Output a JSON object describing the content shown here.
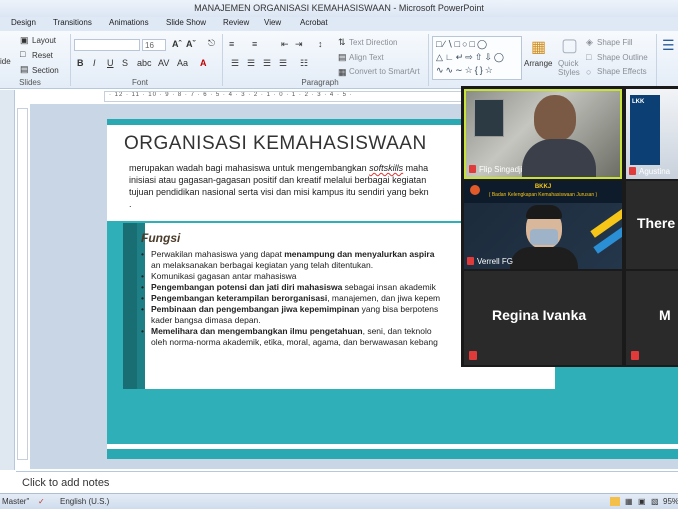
{
  "window": {
    "title": "MANAJEMEN ORGANISASI KEMAHASISWAAN - Microsoft PowerPoint"
  },
  "ribbon_tabs": [
    "Design",
    "Transitions",
    "Animations",
    "Slide Show",
    "Review",
    "View",
    "Acrobat"
  ],
  "ribbon": {
    "slides": {
      "label": "Slides",
      "layout": "Layout",
      "reset": "Reset",
      "section": "Section",
      "new_slide_partial": "ide"
    },
    "font": {
      "label": "Font",
      "size": "16"
    },
    "paragraph": {
      "label": "Paragraph",
      "text_direction": "Text Direction",
      "align_text": "Align Text",
      "convert_smartart": "Convert to SmartArt"
    },
    "drawing": {
      "arrange": "Arrange",
      "quick_styles": "Quick Styles",
      "shape_fill": "Shape Fill",
      "shape_outline": "Shape Outline",
      "shape_effects": "Shape Effects"
    }
  },
  "ruler_ticks": "· 12 · 11 · 10 · 9 · 8 · 7 · 6 · 5 · 4 · 3 · 2 · 1 · 0 · 1 · 2 · 3 · 4 · 5 ·",
  "slide": {
    "title": "ORGANISASI KEMAHASISWAAN",
    "intro_pre": "merupakan wadah bagi mahasiswa untuk mengembangkan ",
    "intro_soft": "softskills",
    "intro_post": " maha",
    "intro_line2": "inisiasi atau gagasan-gagasan positif dan kreatif melalui berbagai kegiatan",
    "intro_line3": "tujuan pendidikan nasional serta visi dan misi kampus itu sendiri yang bekn",
    "intro_line4": ".",
    "box_title": "Fungsi",
    "items": [
      {
        "pre": "Perwakilan mahasiswa yang dapat ",
        "bold": "menampung dan menyalurkan aspira",
        "post": ""
      },
      {
        "pre": "an melaksanakan berbagai kegiatan yang telah ditentukan.",
        "bold": "",
        "post": "",
        "cont": true
      },
      {
        "pre": "Komunikasi gagasan antar mahasiswa",
        "bold": "",
        "post": ""
      },
      {
        "pre": "",
        "bold": "Pengembangan potensi dan jati diri mahasiswa",
        "post": " sebagai insan akademik"
      },
      {
        "pre": "",
        "bold": "Pengembangan keterampilan berorganisasi",
        "post": ", manajemen, dan jiwa kepem"
      },
      {
        "pre": "",
        "bold": "Pembinaan dan pengembangan jiwa kepemimpinan",
        "post": " yang bisa berpotens"
      },
      {
        "pre": "kader bangsa dimasa depan.",
        "bold": "",
        "post": "",
        "cont": true
      },
      {
        "pre": "",
        "bold": "Memelihara dan mengembangkan ilmu pengetahuan",
        "post": ", seni, dan teknolo"
      },
      {
        "pre": "oleh norma-norma akademik, etika, moral, agama, dan berwawasan kebang",
        "bold": "",
        "post": "",
        "cont": true
      }
    ]
  },
  "notes": {
    "placeholder": "Click to add notes"
  },
  "status": {
    "mode": "Master\"",
    "language": "English (U.S.)",
    "zoom": "95%"
  },
  "zoom_call": {
    "participants": [
      {
        "name": "Flip Singadji"
      },
      {
        "name": "Agustina"
      },
      {
        "name": "Verrell FG"
      },
      {
        "name": "There"
      },
      {
        "name": "Regina Ivanka"
      },
      {
        "name": "M"
      }
    ],
    "tile2_logo": "LKK",
    "tile3_banner_1": "BKKJ",
    "tile3_banner_2": "( Badan Kelengkapan Kemahasiswaan Jurusan )"
  },
  "colors": {
    "teal": "#2fb0b8",
    "dark_teal": "#1f7f86",
    "ribbon": "#dfe9f5",
    "zoom_bg": "#1a1a1a",
    "mic_muted": "#e03a3a"
  }
}
